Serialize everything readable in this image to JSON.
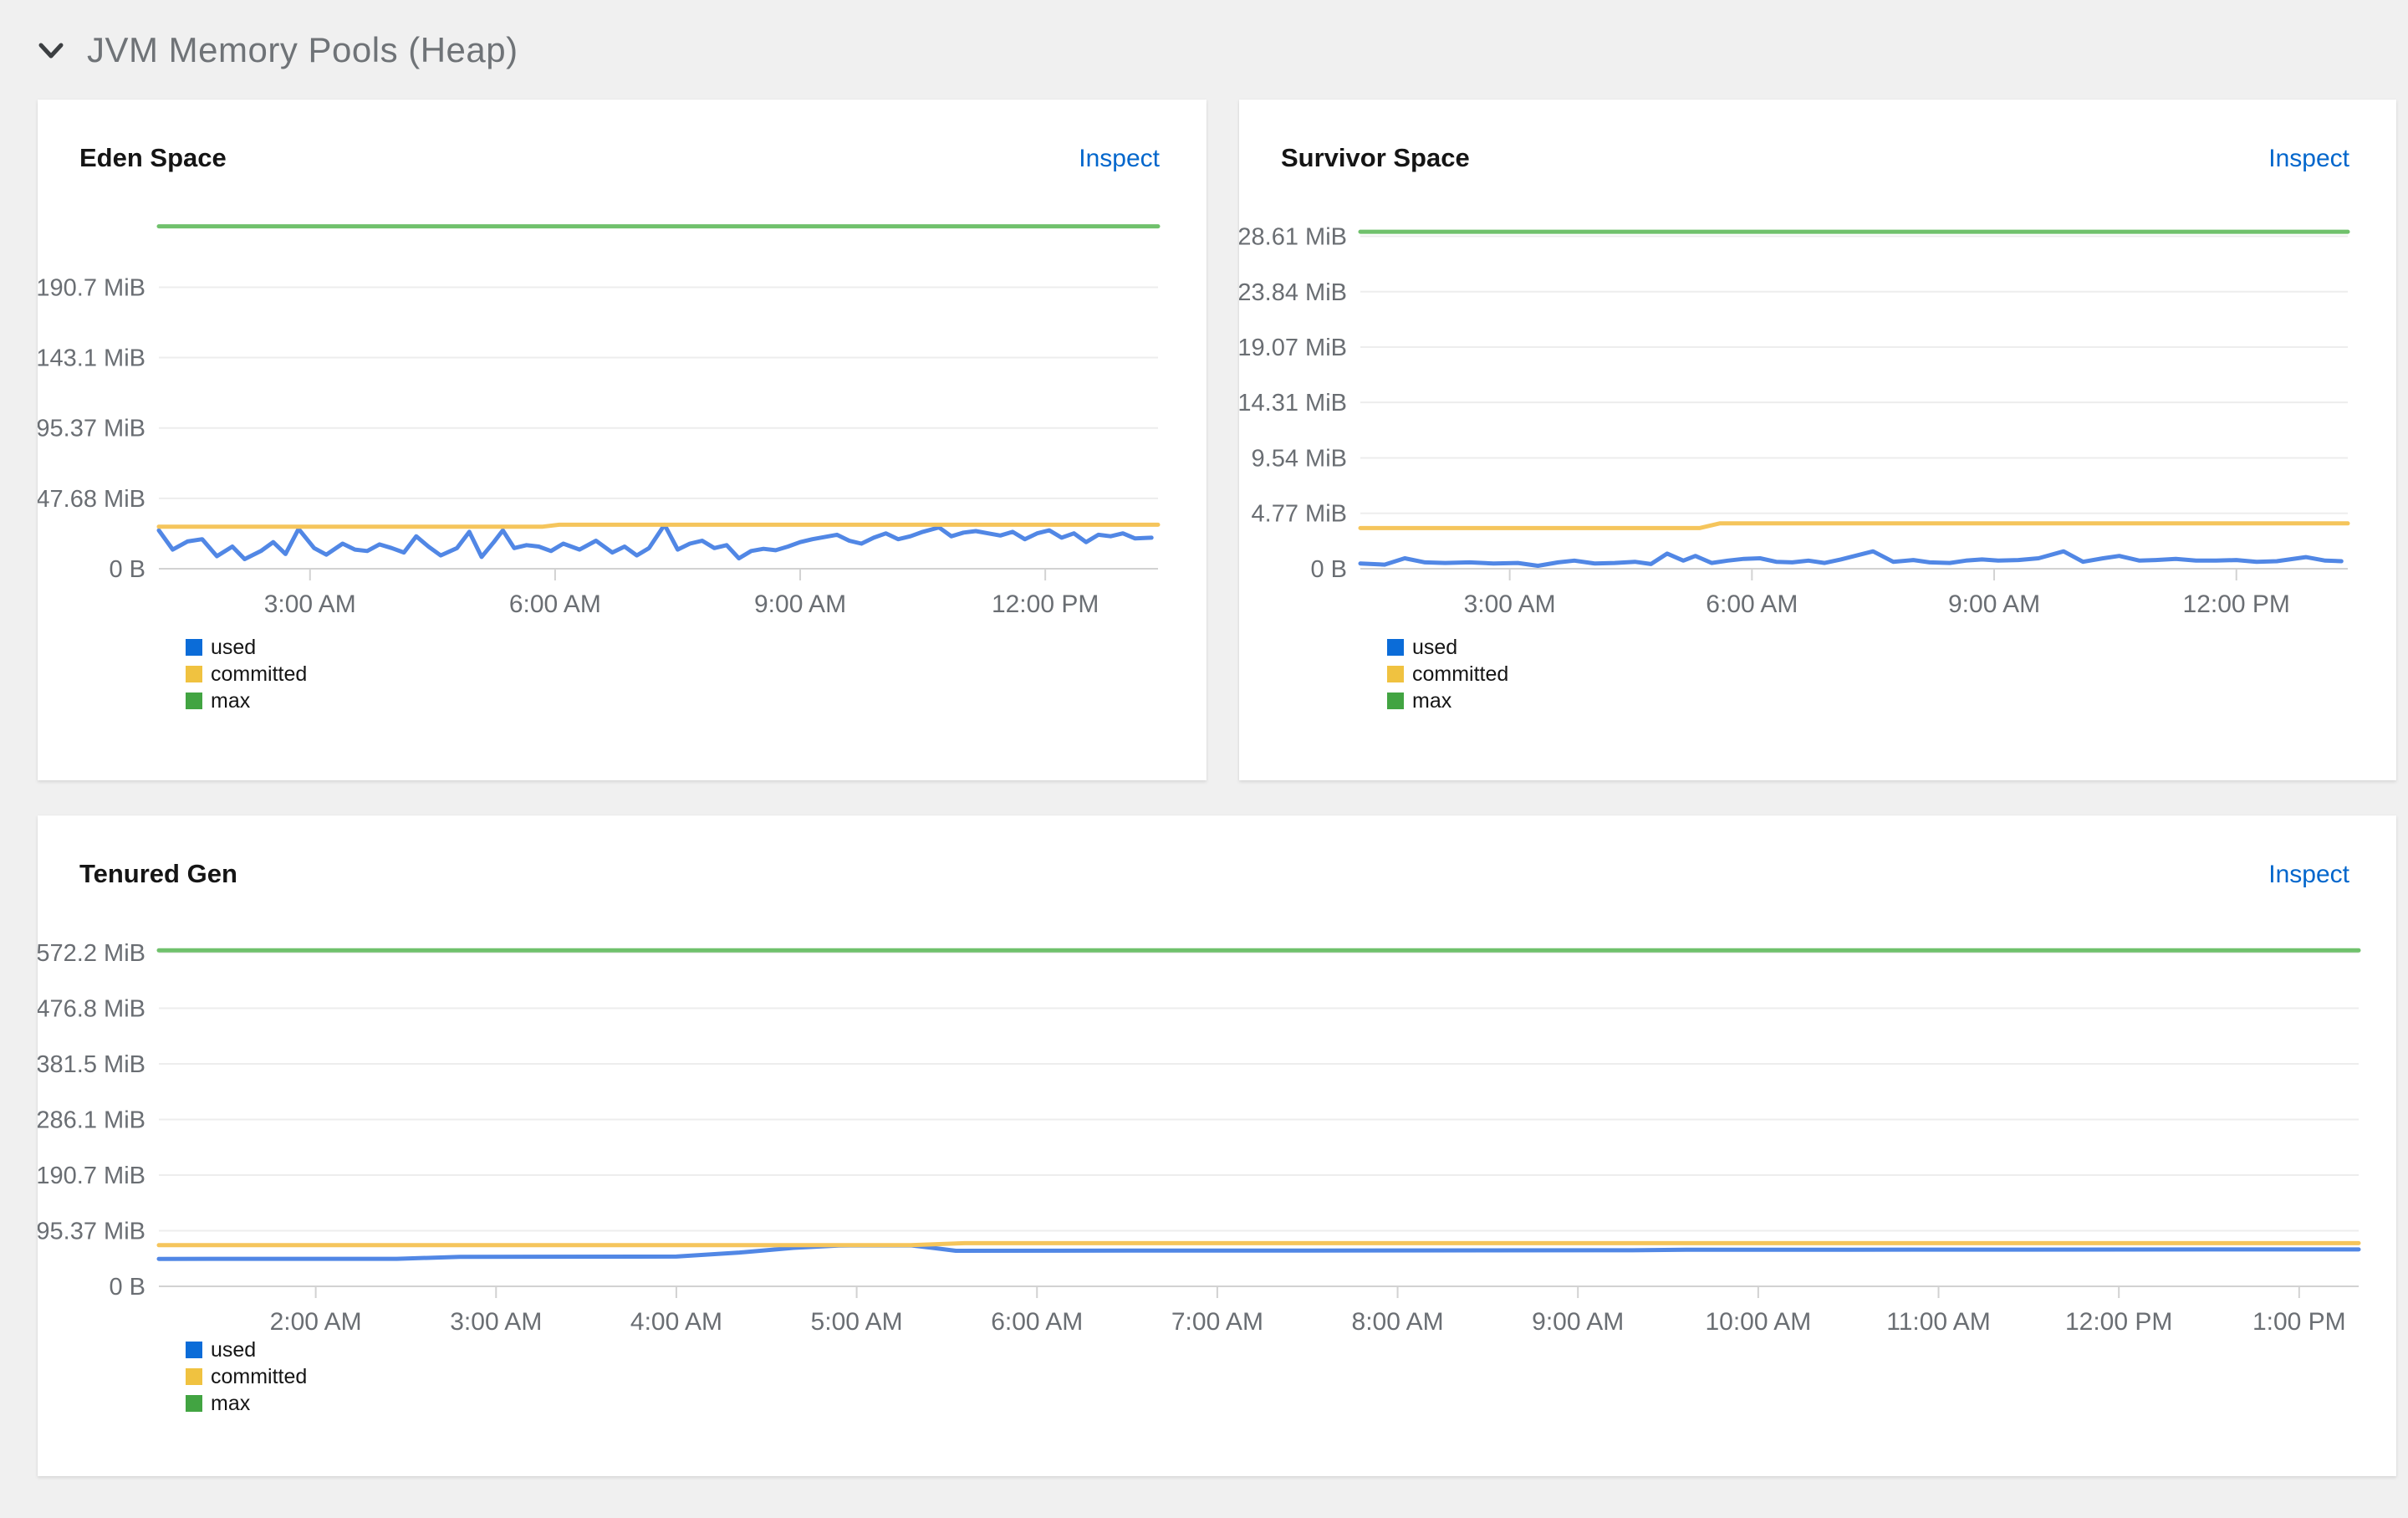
{
  "header": {
    "title": "JVM Memory Pools (Heap)"
  },
  "colors": {
    "page_background": "#f0f0f0",
    "panel_background": "#ffffff",
    "link": "#0066cc",
    "title_text": "#151515",
    "header_text": "#6f7377",
    "axis_label": "#6a6e73",
    "gridline": "#ededed",
    "axis_line": "#d2d2d2",
    "used": "#0b6cd8",
    "committed": "#f0c240",
    "max": "#42a442",
    "used_line": "#5187e5",
    "committed_line": "#f5c55c",
    "max_line": "#70c16c"
  },
  "panels": [
    {
      "title": "Eden Space",
      "action_label": "Inspect",
      "legend": [
        "used",
        "committed",
        "max"
      ]
    },
    {
      "title": "Survivor Space",
      "action_label": "Inspect",
      "legend": [
        "used",
        "committed",
        "max"
      ]
    },
    {
      "title": "Tenured Gen",
      "action_label": "Inspect",
      "legend": [
        "used",
        "committed",
        "max"
      ]
    }
  ],
  "chart_data": [
    {
      "type": "line",
      "title": "Eden Space",
      "ylabel": "",
      "xlabel": "",
      "grid": true,
      "legend_position": "bottom-left",
      "xlim": [
        1.15,
        13.38
      ],
      "ylim": [
        0,
        238.6
      ],
      "x_ticks": [
        {
          "t": 3,
          "label": "3:00 AM"
        },
        {
          "t": 6,
          "label": "6:00 AM"
        },
        {
          "t": 9,
          "label": "9:00 AM"
        },
        {
          "t": 12,
          "label": "12:00 PM"
        }
      ],
      "y_ticks": [
        {
          "v": 0,
          "label": "0 B"
        },
        {
          "v": 47.68,
          "label": "47.68 MiB"
        },
        {
          "v": 95.37,
          "label": "95.37 MiB"
        },
        {
          "v": 143.1,
          "label": "143.1 MiB"
        },
        {
          "v": 190.7,
          "label": "190.7 MiB"
        }
      ],
      "series": [
        {
          "name": "used",
          "points": [
            [
              1.15,
              26
            ],
            [
              1.32,
              13
            ],
            [
              1.5,
              18.5
            ],
            [
              1.68,
              20
            ],
            [
              1.86,
              8.5
            ],
            [
              2.05,
              15
            ],
            [
              2.2,
              6.5
            ],
            [
              2.4,
              12
            ],
            [
              2.55,
              18
            ],
            [
              2.7,
              10
            ],
            [
              2.86,
              27
            ],
            [
              3.05,
              14
            ],
            [
              3.2,
              9.5
            ],
            [
              3.4,
              17
            ],
            [
              3.55,
              13
            ],
            [
              3.7,
              12
            ],
            [
              3.85,
              16.5
            ],
            [
              4.0,
              14
            ],
            [
              4.15,
              11
            ],
            [
              4.3,
              22
            ],
            [
              4.45,
              15
            ],
            [
              4.6,
              9
            ],
            [
              4.8,
              14
            ],
            [
              4.95,
              25
            ],
            [
              5.1,
              8
            ],
            [
              5.25,
              18
            ],
            [
              5.36,
              26
            ],
            [
              5.5,
              14
            ],
            [
              5.65,
              16
            ],
            [
              5.8,
              15
            ],
            [
              5.95,
              12
            ],
            [
              6.1,
              17
            ],
            [
              6.3,
              13
            ],
            [
              6.5,
              19
            ],
            [
              6.7,
              11
            ],
            [
              6.85,
              15
            ],
            [
              7.0,
              9
            ],
            [
              7.15,
              14
            ],
            [
              7.34,
              29.8
            ],
            [
              7.5,
              13
            ],
            [
              7.65,
              17
            ],
            [
              7.8,
              19
            ],
            [
              7.95,
              14
            ],
            [
              8.1,
              16
            ],
            [
              8.25,
              7
            ],
            [
              8.4,
              12
            ],
            [
              8.55,
              13.5
            ],
            [
              8.7,
              12.5
            ],
            [
              8.85,
              15
            ],
            [
              9.0,
              18
            ],
            [
              9.15,
              20
            ],
            [
              9.3,
              21.5
            ],
            [
              9.45,
              23
            ],
            [
              9.6,
              19
            ],
            [
              9.75,
              17
            ],
            [
              9.9,
              21
            ],
            [
              10.05,
              24
            ],
            [
              10.2,
              20
            ],
            [
              10.35,
              22
            ],
            [
              10.5,
              25
            ],
            [
              10.7,
              28
            ],
            [
              10.85,
              22
            ],
            [
              11.0,
              24.5
            ],
            [
              11.15,
              25.5
            ],
            [
              11.3,
              24
            ],
            [
              11.45,
              22.5
            ],
            [
              11.6,
              25
            ],
            [
              11.75,
              20
            ],
            [
              11.9,
              24
            ],
            [
              12.05,
              26
            ],
            [
              12.2,
              21
            ],
            [
              12.35,
              24
            ],
            [
              12.5,
              18
            ],
            [
              12.65,
              23
            ],
            [
              12.8,
              22
            ],
            [
              12.95,
              24
            ],
            [
              13.1,
              20.5
            ],
            [
              13.3,
              21
            ]
          ]
        },
        {
          "name": "committed",
          "points": [
            [
              1.15,
              28.5
            ],
            [
              5.85,
              28.5
            ],
            [
              6.05,
              29.8
            ],
            [
              13.38,
              29.8
            ]
          ]
        },
        {
          "name": "max",
          "points": [
            [
              1.15,
              232
            ],
            [
              13.38,
              232
            ]
          ]
        }
      ]
    },
    {
      "type": "line",
      "title": "Survivor Space",
      "ylabel": "",
      "xlabel": "",
      "grid": true,
      "legend_position": "bottom-left",
      "xlim": [
        1.15,
        13.38
      ],
      "ylim": [
        0,
        30.3
      ],
      "x_ticks": [
        {
          "t": 3,
          "label": "3:00 AM"
        },
        {
          "t": 6,
          "label": "6:00 AM"
        },
        {
          "t": 9,
          "label": "9:00 AM"
        },
        {
          "t": 12,
          "label": "12:00 PM"
        }
      ],
      "y_ticks": [
        {
          "v": 0,
          "label": "0 B"
        },
        {
          "v": 4.77,
          "label": "4.77 MiB"
        },
        {
          "v": 9.54,
          "label": "9.54 MiB"
        },
        {
          "v": 14.31,
          "label": "14.31 MiB"
        },
        {
          "v": 19.07,
          "label": "19.07 MiB"
        },
        {
          "v": 23.84,
          "label": "23.84 MiB"
        },
        {
          "v": 28.61,
          "label": "28.61 MiB"
        }
      ],
      "series": [
        {
          "name": "used",
          "points": [
            [
              1.15,
              0.45
            ],
            [
              1.45,
              0.35
            ],
            [
              1.7,
              0.9
            ],
            [
              1.95,
              0.55
            ],
            [
              2.2,
              0.5
            ],
            [
              2.5,
              0.55
            ],
            [
              2.8,
              0.45
            ],
            [
              3.1,
              0.5
            ],
            [
              3.35,
              0.25
            ],
            [
              3.6,
              0.55
            ],
            [
              3.8,
              0.7
            ],
            [
              4.05,
              0.45
            ],
            [
              4.3,
              0.5
            ],
            [
              4.55,
              0.6
            ],
            [
              4.75,
              0.4
            ],
            [
              4.95,
              1.3
            ],
            [
              5.15,
              0.7
            ],
            [
              5.3,
              1.1
            ],
            [
              5.5,
              0.5
            ],
            [
              5.7,
              0.7
            ],
            [
              5.9,
              0.85
            ],
            [
              6.1,
              0.9
            ],
            [
              6.3,
              0.6
            ],
            [
              6.5,
              0.55
            ],
            [
              6.7,
              0.7
            ],
            [
              6.9,
              0.5
            ],
            [
              7.1,
              0.8
            ],
            [
              7.5,
              1.5
            ],
            [
              7.75,
              0.6
            ],
            [
              8.0,
              0.75
            ],
            [
              8.2,
              0.55
            ],
            [
              8.45,
              0.5
            ],
            [
              8.65,
              0.7
            ],
            [
              8.85,
              0.8
            ],
            [
              9.05,
              0.7
            ],
            [
              9.3,
              0.75
            ],
            [
              9.55,
              0.9
            ],
            [
              9.86,
              1.5
            ],
            [
              10.1,
              0.6
            ],
            [
              10.35,
              0.9
            ],
            [
              10.55,
              1.1
            ],
            [
              10.8,
              0.7
            ],
            [
              11.0,
              0.75
            ],
            [
              11.25,
              0.85
            ],
            [
              11.5,
              0.7
            ],
            [
              11.75,
              0.7
            ],
            [
              12.0,
              0.75
            ],
            [
              12.25,
              0.6
            ],
            [
              12.5,
              0.65
            ],
            [
              12.86,
              1.0
            ],
            [
              13.1,
              0.7
            ],
            [
              13.3,
              0.65
            ]
          ]
        },
        {
          "name": "committed",
          "points": [
            [
              1.15,
              3.5
            ],
            [
              5.35,
              3.5
            ],
            [
              5.6,
              3.9
            ],
            [
              13.38,
              3.9
            ]
          ]
        },
        {
          "name": "max",
          "points": [
            [
              1.15,
              29
            ],
            [
              13.38,
              29
            ]
          ]
        }
      ]
    },
    {
      "type": "line",
      "title": "Tenured Gen",
      "ylabel": "",
      "xlabel": "",
      "grid": true,
      "legend_position": "bottom-left",
      "xlim": [
        1.13,
        13.33
      ],
      "ylim": [
        0,
        598
      ],
      "x_ticks": [
        {
          "t": 2,
          "label": "2:00 AM"
        },
        {
          "t": 3,
          "label": "3:00 AM"
        },
        {
          "t": 4,
          "label": "4:00 AM"
        },
        {
          "t": 5,
          "label": "5:00 AM"
        },
        {
          "t": 6,
          "label": "6:00 AM"
        },
        {
          "t": 7,
          "label": "7:00 AM"
        },
        {
          "t": 8,
          "label": "8:00 AM"
        },
        {
          "t": 9,
          "label": "9:00 AM"
        },
        {
          "t": 10,
          "label": "10:00 AM"
        },
        {
          "t": 11,
          "label": "11:00 AM"
        },
        {
          "t": 12,
          "label": "12:00 PM"
        },
        {
          "t": 13,
          "label": "1:00 PM"
        }
      ],
      "y_ticks": [
        {
          "v": 0,
          "label": "0 B"
        },
        {
          "v": 95.37,
          "label": "95.37 MiB"
        },
        {
          "v": 190.7,
          "label": "190.7 MiB"
        },
        {
          "v": 286.1,
          "label": "286.1 MiB"
        },
        {
          "v": 381.5,
          "label": "381.5 MiB"
        },
        {
          "v": 476.8,
          "label": "476.8 MiB"
        },
        {
          "v": 572.2,
          "label": "572.2 MiB"
        }
      ],
      "series": [
        {
          "name": "used",
          "points": [
            [
              1.13,
              47
            ],
            [
              2.45,
              47.2
            ],
            [
              2.8,
              50.5
            ],
            [
              4.0,
              51
            ],
            [
              4.35,
              58
            ],
            [
              4.65,
              66
            ],
            [
              4.9,
              70
            ],
            [
              5.3,
              70.2
            ],
            [
              5.42,
              66
            ],
            [
              5.55,
              61
            ],
            [
              6.5,
              61.2
            ],
            [
              7.5,
              61.4
            ],
            [
              8.5,
              61.6
            ],
            [
              9.3,
              61.8
            ],
            [
              9.6,
              62.6
            ],
            [
              10.5,
              62.8
            ],
            [
              11.5,
              63
            ],
            [
              12.5,
              63.2
            ],
            [
              13.33,
              63.3
            ]
          ]
        },
        {
          "name": "committed",
          "points": [
            [
              1.13,
              70.5
            ],
            [
              5.3,
              70.5
            ],
            [
              5.6,
              74
            ],
            [
              13.33,
              74
            ]
          ]
        },
        {
          "name": "max",
          "points": [
            [
              1.13,
              576
            ],
            [
              13.33,
              576
            ]
          ]
        }
      ]
    }
  ]
}
